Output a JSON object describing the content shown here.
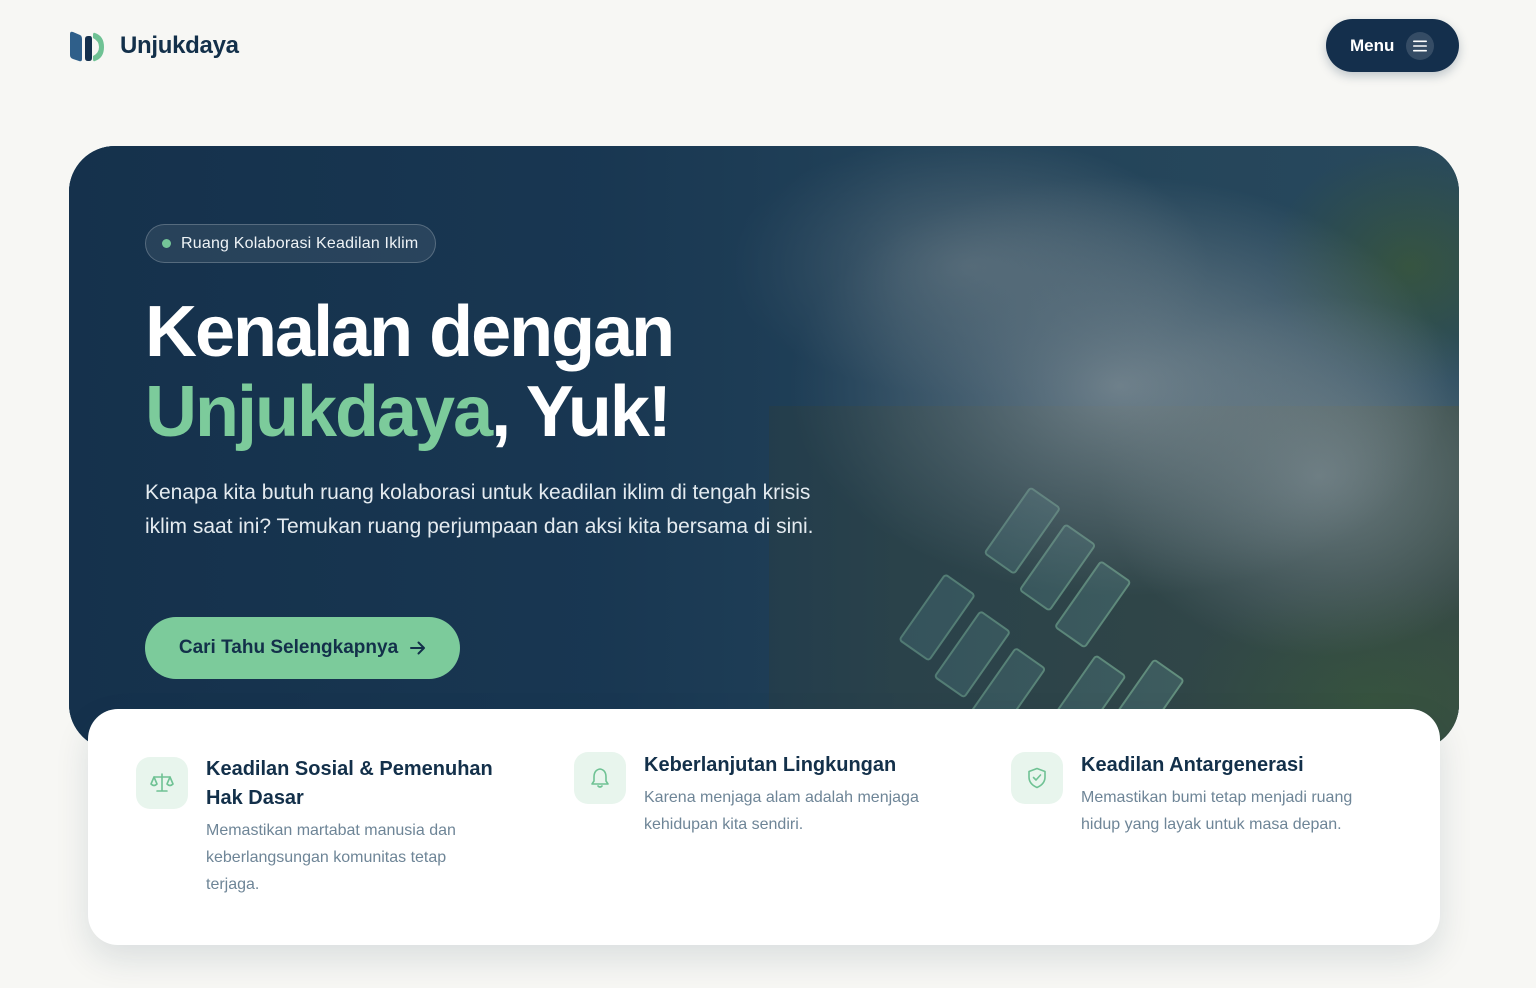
{
  "header": {
    "brand_name": "Unjukdaya",
    "menu_label": "Menu",
    "logo_icon": "unjukdaya-logo",
    "menu_icon": "hamburger-icon"
  },
  "hero": {
    "badge": "Ruang Kolaborasi Keadilan Iklim",
    "title_line1": "Kenalan dengan",
    "title_accent": "Unjukdaya",
    "title_rest": ", Yuk!",
    "description": "Kenapa kita butuh ruang kolaborasi untuk keadilan iklim di tengah krisis iklim saat ini? Temukan ruang perjumpaan dan aksi kita bersama di sini.",
    "cta_label": "Cari Tahu Selengkapnya",
    "cta_icon": "arrow-right-icon"
  },
  "features": [
    {
      "title": "Keadilan Sosial & Pemenuhan Hak Dasar",
      "description": "Memastikan martabat manusia dan keberlangsungan komunitas tetap terjaga.",
      "icon": "scale-icon"
    },
    {
      "title": "Keberlanjutan Lingkungan",
      "description": "Karena menjaga alam adalah menjaga kehidupan kita sendiri.",
      "icon": "bell-icon"
    },
    {
      "title": "Keadilan Antargenerasi",
      "description": "Memastikan bumi tetap menjadi ruang hidup yang layak untuk masa depan.",
      "icon": "shield-check-icon"
    }
  ],
  "colors": {
    "navy": "#142f4c",
    "accent_green": "#7ccb9b",
    "page_bg": "#f7f7f4"
  }
}
